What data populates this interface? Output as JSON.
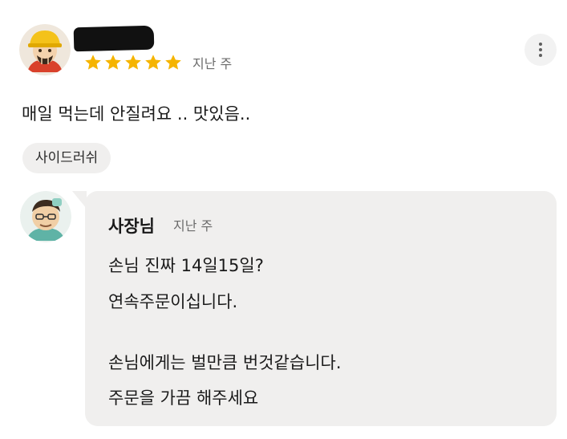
{
  "review": {
    "rating": 5,
    "rating_max": 5,
    "star_color": "#f5b400",
    "date": "지난 주",
    "text": "매일 먹는데 안질려요 .. 맛있음..",
    "menu_chip": "사이드러쉬",
    "avatar_icon": "cartoon-worker-avatar-icon"
  },
  "reply": {
    "author": "사장님",
    "date": "지난 주",
    "lines": [
      "손님 진짜 14일15일?",
      "연속주문이십니다.",
      "손님에게는 벌만큼 번것같습니다.",
      "주문을 가끔 해주세요"
    ],
    "avatar_icon": "cartoon-owner-avatar-icon",
    "bubble_color": "#f0efee"
  },
  "more_icon": "more-vertical-icon"
}
